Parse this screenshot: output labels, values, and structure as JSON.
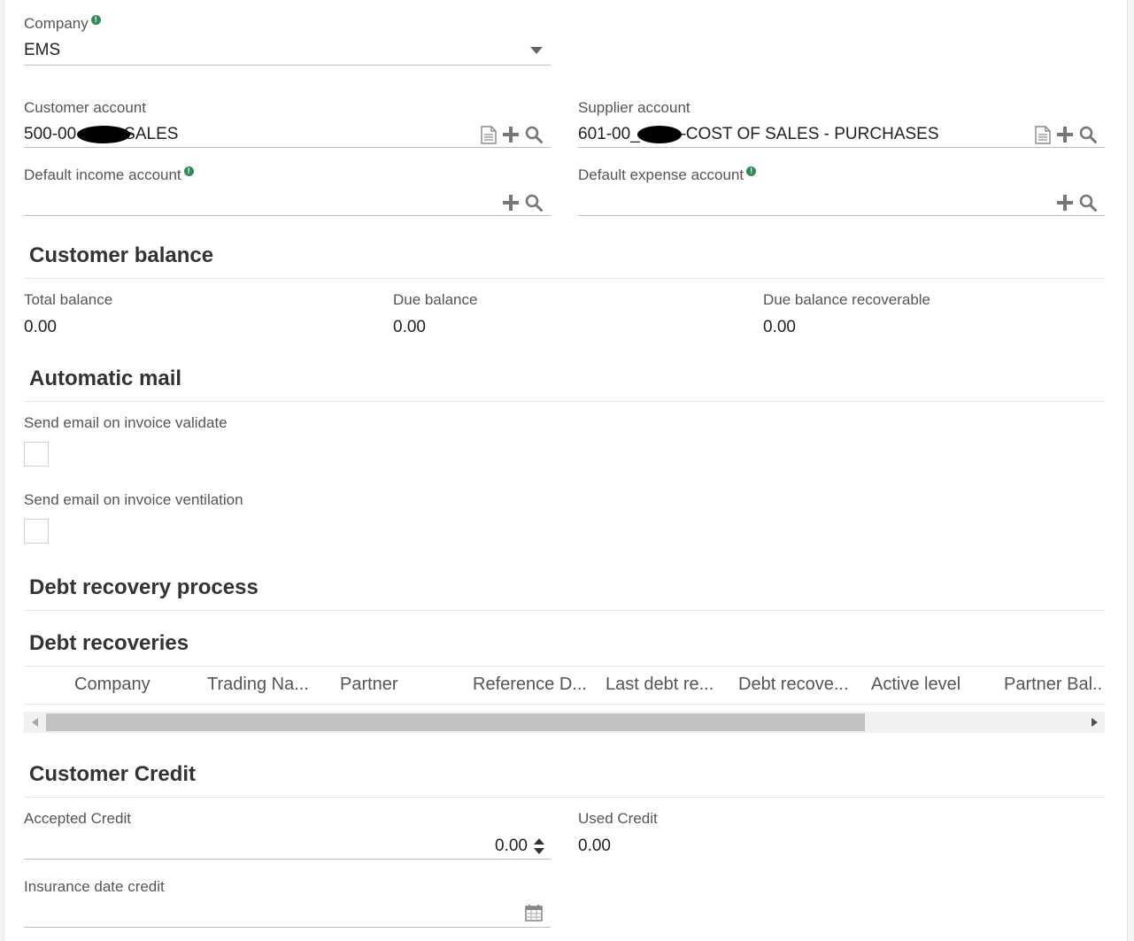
{
  "company": {
    "label": "Company",
    "value": "EMS"
  },
  "customer_account": {
    "label": "Customer account",
    "prefix": "500-00",
    "suffix": "SALES"
  },
  "supplier_account": {
    "label": "Supplier account",
    "prefix": "601-00_",
    "suffix": "COST OF SALES - PURCHASES"
  },
  "default_income_account": {
    "label": "Default income account",
    "value": ""
  },
  "default_expense_account": {
    "label": "Default expense account",
    "value": ""
  },
  "customer_balance": {
    "title": "Customer balance",
    "total_label": "Total balance",
    "total_value": "0.00",
    "due_label": "Due balance",
    "due_value": "0.00",
    "recoverable_label": "Due balance recoverable",
    "recoverable_value": "0.00"
  },
  "automatic_mail": {
    "title": "Automatic mail",
    "validate_label": "Send email on invoice validate",
    "ventilation_label": "Send email on invoice ventilation"
  },
  "debt_recovery_process": {
    "title": "Debt recovery process"
  },
  "debt_recoveries": {
    "title": "Debt recoveries",
    "columns": [
      "Company",
      "Trading Na...",
      "Partner",
      "Reference D...",
      "Last debt re...",
      "Debt recove...",
      "Active level",
      "Partner Bal.."
    ]
  },
  "customer_credit": {
    "title": "Customer Credit",
    "accepted_label": "Accepted Credit",
    "accepted_value": "0.00",
    "used_label": "Used Credit",
    "used_value": "0.00",
    "insurance_label": "Insurance date credit",
    "insurance_value": ""
  },
  "colors": {
    "required": "#2e8b57",
    "scroll_thumb": "#c1c1c1",
    "scroll_track": "#f1f1f1"
  },
  "icons": [
    "required-icon",
    "dropdown-icon",
    "document-icon",
    "plus-icon",
    "search-icon",
    "spinner-icon",
    "calendar-icon",
    "scroll-left-icon",
    "scroll-right-icon"
  ]
}
